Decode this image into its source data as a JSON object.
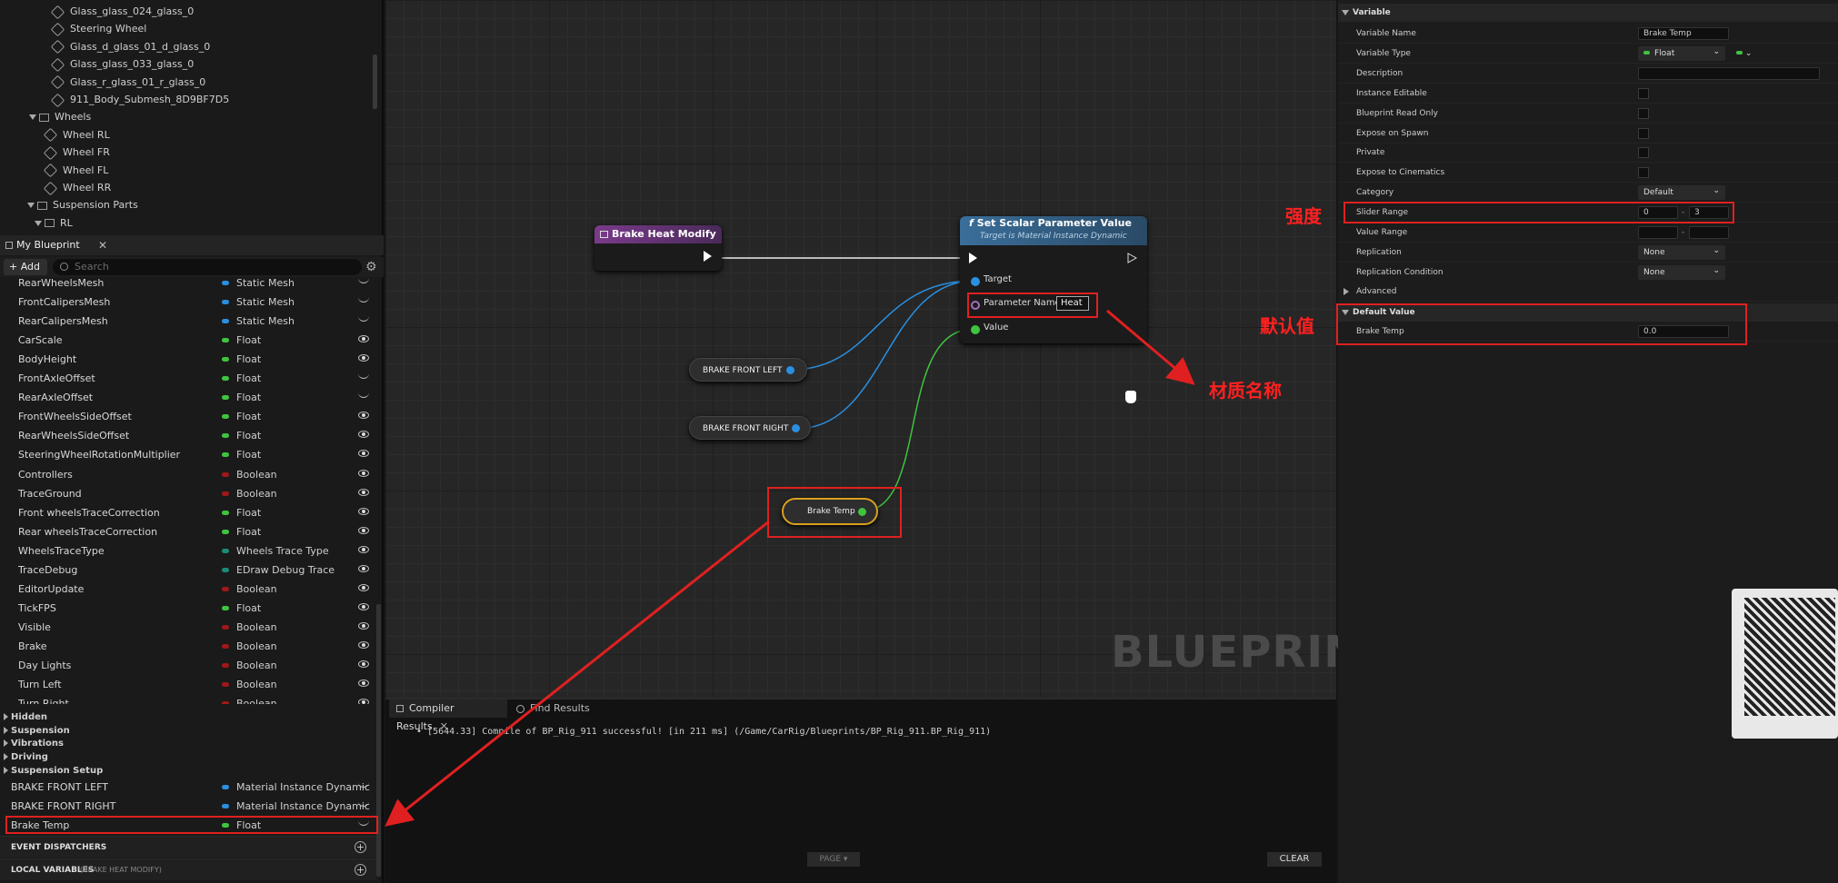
{
  "outliner": {
    "items": [
      {
        "label": "Glass_glass_024_glass_0",
        "kind": "mesh"
      },
      {
        "label": "Steering Wheel",
        "kind": "mesh"
      },
      {
        "label": "Glass_d_glass_01_d_glass_0",
        "kind": "mesh"
      },
      {
        "label": "Glass_glass_033_glass_0",
        "kind": "mesh"
      },
      {
        "label": "Glass_r_glass_01_r_glass_0",
        "kind": "mesh"
      },
      {
        "label": "911_Body_Submesh_8D9BF7D5",
        "kind": "mesh"
      },
      {
        "label": "Wheels",
        "kind": "group"
      },
      {
        "label": "Wheel RL",
        "kind": "mesh"
      },
      {
        "label": "Wheel FR",
        "kind": "mesh"
      },
      {
        "label": "Wheel FL",
        "kind": "mesh"
      },
      {
        "label": "Wheel RR",
        "kind": "mesh"
      },
      {
        "label": "Suspension Parts",
        "kind": "group"
      },
      {
        "label": "RL",
        "kind": "group"
      }
    ]
  },
  "my_blueprint": {
    "tab_label": "My Blueprint",
    "add_label": "+ Add",
    "search_placeholder": "Search",
    "variables": [
      {
        "name": "RearWheelsMesh",
        "type": "Static Mesh",
        "color": "#2b8fe0",
        "vis": "closed"
      },
      {
        "name": "FrontCalipersMesh",
        "type": "Static Mesh",
        "color": "#2b8fe0",
        "vis": "closed"
      },
      {
        "name": "RearCalipersMesh",
        "type": "Static Mesh",
        "color": "#2b8fe0",
        "vis": "closed"
      },
      {
        "name": "CarScale",
        "type": "Float",
        "color": "#3fc43f",
        "vis": "open"
      },
      {
        "name": "BodyHeight",
        "type": "Float",
        "color": "#3fc43f",
        "vis": "open"
      },
      {
        "name": "FrontAxleOffset",
        "type": "Float",
        "color": "#3fc43f",
        "vis": "closed"
      },
      {
        "name": "RearAxleOffset",
        "type": "Float",
        "color": "#3fc43f",
        "vis": "closed"
      },
      {
        "name": "FrontWheelsSideOffset",
        "type": "Float",
        "color": "#3fc43f",
        "vis": "open"
      },
      {
        "name": "RearWheelsSideOffset",
        "type": "Float",
        "color": "#3fc43f",
        "vis": "open"
      },
      {
        "name": "SteeringWheelRotationMultiplier",
        "type": "Float",
        "color": "#3fc43f",
        "vis": "open"
      },
      {
        "name": "Controllers",
        "type": "Boolean",
        "color": "#a01818",
        "vis": "open"
      },
      {
        "name": "TraceGround",
        "type": "Boolean",
        "color": "#a01818",
        "vis": "open"
      },
      {
        "name": "Front wheelsTraceCorrection",
        "type": "Float",
        "color": "#3fc43f",
        "vis": "open"
      },
      {
        "name": "Rear wheelsTraceCorrection",
        "type": "Float",
        "color": "#3fc43f",
        "vis": "open"
      },
      {
        "name": "WheelsTraceType",
        "type": "Wheels Trace Type",
        "color": "#1c8a78",
        "vis": "open"
      },
      {
        "name": "TraceDebug",
        "type": "EDraw Debug Trace",
        "color": "#1c8a78",
        "vis": "open"
      },
      {
        "name": "EditorUpdate",
        "type": "Boolean",
        "color": "#a01818",
        "vis": "open"
      },
      {
        "name": "TickFPS",
        "type": "Float",
        "color": "#3fc43f",
        "vis": "open"
      },
      {
        "name": "Visible",
        "type": "Boolean",
        "color": "#a01818",
        "vis": "open"
      },
      {
        "name": "Brake",
        "type": "Boolean",
        "color": "#a01818",
        "vis": "open"
      },
      {
        "name": "Day Lights",
        "type": "Boolean",
        "color": "#a01818",
        "vis": "open"
      },
      {
        "name": "Turn Left",
        "type": "Boolean",
        "color": "#a01818",
        "vis": "open"
      },
      {
        "name": "Turn Right",
        "type": "Boolean",
        "color": "#a01818",
        "vis": "open"
      }
    ],
    "categories": [
      "Hidden",
      "Suspension",
      "Vibrations",
      "Driving",
      "Suspension Setup"
    ],
    "extra_vars": [
      {
        "name": "BRAKE FRONT LEFT",
        "type": "Material Instance Dynamic",
        "color": "#2b8fe0"
      },
      {
        "name": "BRAKE FRONT RIGHT",
        "type": "Material Instance Dynamic",
        "color": "#2b8fe0"
      },
      {
        "name": "Brake Temp",
        "type": "Float",
        "color": "#3fc43f"
      }
    ],
    "event_dispatchers": "EVENT DISPATCHERS",
    "local_variables": "LOCAL VARIABLES",
    "local_variables_sub": "(BRAKE HEAT MODIFY)"
  },
  "graph": {
    "event_node": "Brake Heat Modify",
    "func_title": "Set Scalar Parameter Value",
    "func_subtitle": "Target is Material Instance Dynamic",
    "pin_target": "Target",
    "pin_param": "Parameter Name",
    "param_value": "Heat",
    "pin_value": "Value",
    "get_left": "BRAKE FRONT LEFT",
    "get_right": "BRAKE FRONT RIGHT",
    "get_temp": "Brake Temp",
    "watermark": "BLUEPRINT"
  },
  "output": {
    "tab_compiler": "Compiler Results",
    "tab_find": "Find Results",
    "log": "[5644.33] Compile of BP_Rig_911 successful! [in 211 ms] (/Game/CarRig/Blueprints/BP_Rig_911.BP_Rig_911)",
    "page_label": "PAGE",
    "clear_label": "CLEAR"
  },
  "details": {
    "section_variable": "Variable",
    "rows": [
      {
        "label": "Variable Name",
        "kind": "text",
        "value": "Brake Temp"
      },
      {
        "label": "Variable Type",
        "kind": "dropdown",
        "value": "Float"
      },
      {
        "label": "Description",
        "kind": "wide",
        "value": ""
      },
      {
        "label": "Instance Editable",
        "kind": "check"
      },
      {
        "label": "Blueprint Read Only",
        "kind": "check"
      },
      {
        "label": "Expose on Spawn",
        "kind": "check"
      },
      {
        "label": "Private",
        "kind": "check"
      },
      {
        "label": "Expose to Cinematics",
        "kind": "check"
      },
      {
        "label": "Category",
        "kind": "dropdown",
        "value": "Default"
      },
      {
        "label": "Slider Range",
        "kind": "range",
        "min": "0",
        "max": "3"
      },
      {
        "label": "Value Range",
        "kind": "range",
        "min": "",
        "max": ""
      },
      {
        "label": "Replication",
        "kind": "dropdown",
        "value": "None"
      },
      {
        "label": "Replication Condition",
        "kind": "dropdown",
        "value": "None"
      }
    ],
    "advanced": "Advanced",
    "section_default": "Default Value",
    "default_label": "Brake Temp",
    "default_value": "0.0"
  },
  "annotations": {
    "strength": "强度",
    "default_value": "默认值",
    "material_name": "材质名称"
  },
  "colors": {
    "accent_red": "#e02020",
    "float_pin": "#3fc43f",
    "object_pin": "#2b8fe0"
  }
}
